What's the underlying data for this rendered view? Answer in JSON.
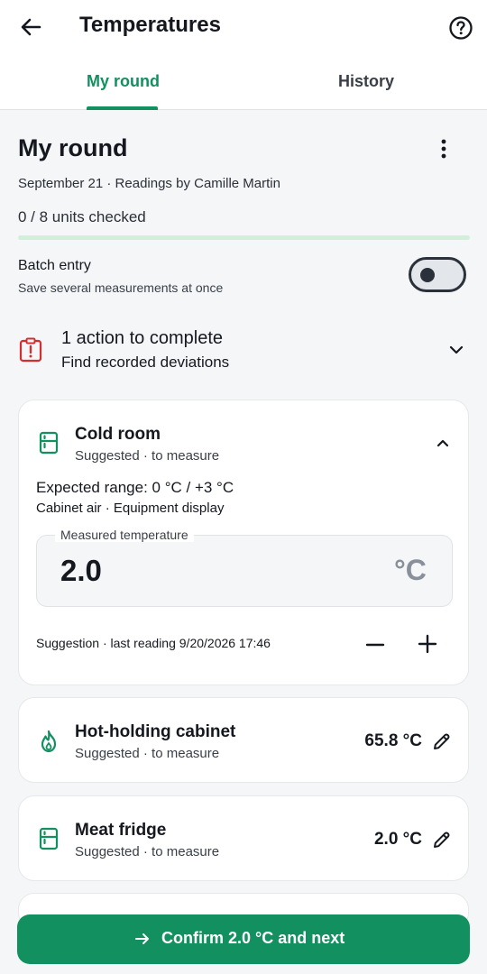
{
  "header": {
    "title": "Temperatures",
    "tabs": [
      "My round",
      "History"
    ]
  },
  "summary": {
    "title": "My round",
    "subtitle": "September 21 · Readings by Camille Martin",
    "units_checked": "0 / 8 units checked",
    "progress_fraction": 0.0
  },
  "batch": {
    "label": "Batch entry",
    "description": "Save several measurements at once",
    "enabled": false
  },
  "action": {
    "title": "1 action to complete",
    "subtitle": "Find recorded deviations"
  },
  "active_unit": {
    "name": "Cold room",
    "status": "Suggested · to measure",
    "range": "Expected range: 0 °C / +3 °C",
    "probe": "Cabinet air · Equipment display",
    "field_label": "Measured temperature",
    "value": "2.0",
    "unit": "°C",
    "suggestion": "Suggestion · last reading 9/20/2026 17:46"
  },
  "units": [
    {
      "name": "Hot-holding cabinet",
      "status": "Suggested · to measure",
      "reading": "65.8 °C",
      "icon": "flame-icon"
    },
    {
      "name": "Meat fridge",
      "status": "Suggested · to measure",
      "reading": "2.0 °C",
      "icon": "fridge-icon"
    }
  ],
  "confirm": {
    "label": "Confirm 2.0 °C and next"
  },
  "colors": {
    "accent": "#13905f",
    "alert": "#d32f2f",
    "text": "#15181f",
    "background": "#f4f6f8"
  }
}
